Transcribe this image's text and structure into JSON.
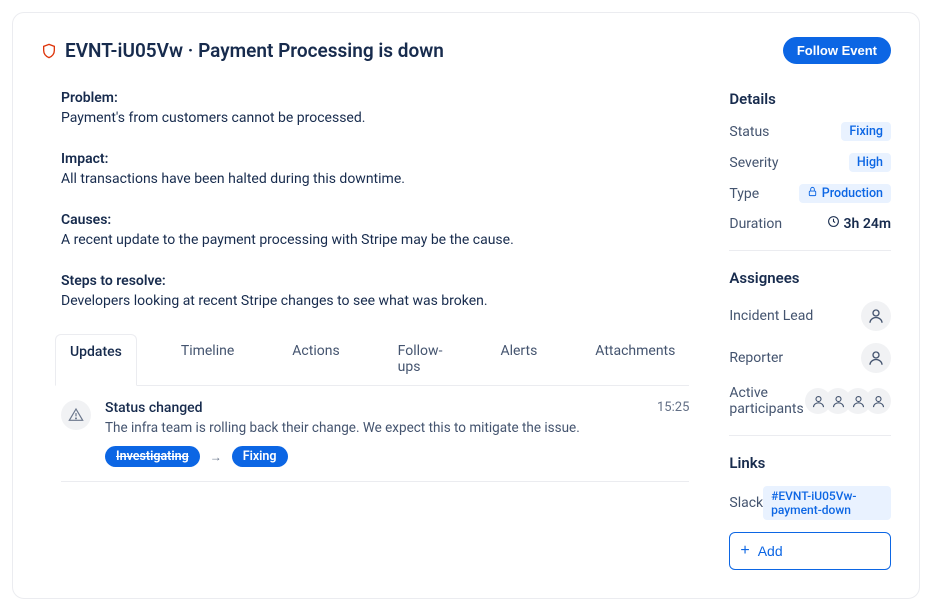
{
  "header": {
    "event_id": "EVNT-iU05Vw",
    "separator": "·",
    "event_title": "Payment Processing is down",
    "follow_label": "Follow Event"
  },
  "summary": {
    "problem_label": "Problem:",
    "problem_text": "Payment's from customers cannot be processed.",
    "impact_label": "Impact:",
    "impact_text": "All transactions have been halted during this downtime.",
    "causes_label": "Causes:",
    "causes_text": "A recent update to the payment processing with Stripe may be the cause.",
    "steps_label": "Steps to resolve:",
    "steps_text": "Developers looking at recent Stripe changes to see what was broken."
  },
  "tabs": {
    "updates": "Updates",
    "timeline": "Timeline",
    "actions": "Actions",
    "followups": "Follow-ups",
    "alerts": "Alerts",
    "attachments": "Attachments"
  },
  "update": {
    "title": "Status changed",
    "desc": "The infra team is rolling back their change. We expect this to mitigate the issue.",
    "time": "15:25",
    "from": "Investigating",
    "arrow": "→",
    "to": "Fixing"
  },
  "details": {
    "heading": "Details",
    "status_label": "Status",
    "status_value": "Fixing",
    "severity_label": "Severity",
    "severity_value": "High",
    "type_label": "Type",
    "type_value": "Production",
    "duration_label": "Duration",
    "duration_value": "3h 24m"
  },
  "assignees": {
    "heading": "Assignees",
    "lead_label": "Incident Lead",
    "reporter_label": "Reporter",
    "participants_label": "Active participants"
  },
  "links": {
    "heading": "Links",
    "slack_label": "Slack",
    "slack_value": "#EVNT-iU05Vw-payment-down",
    "add_label": "Add"
  }
}
